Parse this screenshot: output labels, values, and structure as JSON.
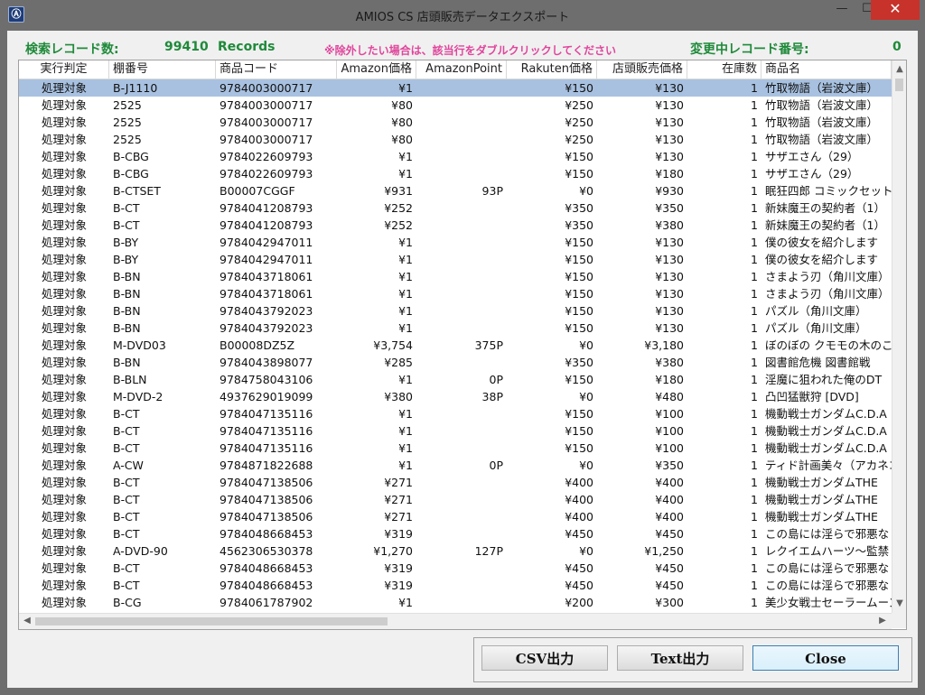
{
  "window": {
    "title": "AMIOS CS 店頭販売データエクスポート",
    "minimize_glyph": "—",
    "maximize_glyph": "☐",
    "close_glyph": "✕"
  },
  "info": {
    "search_count_label": "検索レコード数:",
    "search_count_value": "99410",
    "records_label": "Records",
    "notice": "※除外したい場合は、該当行をダブルクリックしてください",
    "changing_label": "変更中レコード番号:",
    "changing_value": "0"
  },
  "columns": [
    "実行判定",
    "棚番号",
    "商品コード",
    "Amazon価格",
    "AmazonPoint",
    "Rakuten価格",
    "店頭販売価格",
    "在庫数",
    "商品名"
  ],
  "rows": [
    [
      "処理対象",
      "B-J1110",
      "9784003000717",
      "¥1",
      "",
      "¥150",
      "¥130",
      "1",
      "竹取物語（岩波文庫）"
    ],
    [
      "処理対象",
      "2525",
      "9784003000717",
      "¥80",
      "",
      "¥250",
      "¥130",
      "1",
      "竹取物語（岩波文庫）"
    ],
    [
      "処理対象",
      "2525",
      "9784003000717",
      "¥80",
      "",
      "¥250",
      "¥130",
      "1",
      "竹取物語（岩波文庫）"
    ],
    [
      "処理対象",
      "2525",
      "9784003000717",
      "¥80",
      "",
      "¥250",
      "¥130",
      "1",
      "竹取物語（岩波文庫）"
    ],
    [
      "処理対象",
      "B-CBG",
      "9784022609793",
      "¥1",
      "",
      "¥150",
      "¥130",
      "1",
      "サザエさん（29）"
    ],
    [
      "処理対象",
      "B-CBG",
      "9784022609793",
      "¥1",
      "",
      "¥150",
      "¥180",
      "1",
      "サザエさん（29）"
    ],
    [
      "処理対象",
      "B-CTSET",
      "B00007CGGF",
      "¥931",
      "93P",
      "¥0",
      "¥930",
      "1",
      "眠狂四郎 コミックセット"
    ],
    [
      "処理対象",
      "B-CT",
      "9784041208793",
      "¥252",
      "",
      "¥350",
      "¥350",
      "1",
      "新妹魔王の契約者（1）"
    ],
    [
      "処理対象",
      "B-CT",
      "9784041208793",
      "¥252",
      "",
      "¥350",
      "¥380",
      "1",
      "新妹魔王の契約者（1）"
    ],
    [
      "処理対象",
      "B-BY",
      "9784042947011",
      "¥1",
      "",
      "¥150",
      "¥130",
      "1",
      "僕の彼女を紹介します"
    ],
    [
      "処理対象",
      "B-BY",
      "9784042947011",
      "¥1",
      "",
      "¥150",
      "¥130",
      "1",
      "僕の彼女を紹介します"
    ],
    [
      "処理対象",
      "B-BN",
      "9784043718061",
      "¥1",
      "",
      "¥150",
      "¥130",
      "1",
      "さまよう刃（角川文庫）"
    ],
    [
      "処理対象",
      "B-BN",
      "9784043718061",
      "¥1",
      "",
      "¥150",
      "¥130",
      "1",
      "さまよう刃（角川文庫）"
    ],
    [
      "処理対象",
      "B-BN",
      "9784043792023",
      "¥1",
      "",
      "¥150",
      "¥130",
      "1",
      "パズル（角川文庫）"
    ],
    [
      "処理対象",
      "B-BN",
      "9784043792023",
      "¥1",
      "",
      "¥150",
      "¥130",
      "1",
      "パズル（角川文庫）"
    ],
    [
      "処理対象",
      "M-DVD03",
      "B00008DZ5Z",
      "¥3,754",
      "375P",
      "¥0",
      "¥3,180",
      "1",
      "ぼのぼの クモモの木のこ"
    ],
    [
      "処理対象",
      "B-BN",
      "9784043898077",
      "¥285",
      "",
      "¥350",
      "¥380",
      "1",
      "図書館危機 図書館戦"
    ],
    [
      "処理対象",
      "B-BLN",
      "9784758043106",
      "¥1",
      "0P",
      "¥150",
      "¥180",
      "1",
      "淫魔に狙われた俺のDT"
    ],
    [
      "処理対象",
      "M-DVD-2",
      "4937629019099",
      "¥380",
      "38P",
      "¥0",
      "¥480",
      "1",
      "凸凹猛獣狩 [DVD]"
    ],
    [
      "処理対象",
      "B-CT",
      "9784047135116",
      "¥1",
      "",
      "¥150",
      "¥100",
      "1",
      "機動戦士ガンダムC.D.A"
    ],
    [
      "処理対象",
      "B-CT",
      "9784047135116",
      "¥1",
      "",
      "¥150",
      "¥100",
      "1",
      "機動戦士ガンダムC.D.A"
    ],
    [
      "処理対象",
      "B-CT",
      "9784047135116",
      "¥1",
      "",
      "¥150",
      "¥100",
      "1",
      "機動戦士ガンダムC.D.A"
    ],
    [
      "処理対象",
      "A-CW",
      "9784871822688",
      "¥1",
      "0P",
      "¥0",
      "¥350",
      "1",
      "ティド計画美々（アカネコ"
    ],
    [
      "処理対象",
      "B-CT",
      "9784047138506",
      "¥271",
      "",
      "¥400",
      "¥400",
      "1",
      "機動戦士ガンダムTHE"
    ],
    [
      "処理対象",
      "B-CT",
      "9784047138506",
      "¥271",
      "",
      "¥400",
      "¥400",
      "1",
      "機動戦士ガンダムTHE"
    ],
    [
      "処理対象",
      "B-CT",
      "9784047138506",
      "¥271",
      "",
      "¥400",
      "¥400",
      "1",
      "機動戦士ガンダムTHE"
    ],
    [
      "処理対象",
      "B-CT",
      "9784048668453",
      "¥319",
      "",
      "¥450",
      "¥450",
      "1",
      "この島には淫らで邪悪な"
    ],
    [
      "処理対象",
      "A-DVD-90",
      "4562306530378",
      "¥1,270",
      "127P",
      "¥0",
      "¥1,250",
      "1",
      "レクイエムハーツ〜監禁"
    ],
    [
      "処理対象",
      "B-CT",
      "9784048668453",
      "¥319",
      "",
      "¥450",
      "¥450",
      "1",
      "この島には淫らで邪悪な"
    ],
    [
      "処理対象",
      "B-CT",
      "9784048668453",
      "¥319",
      "",
      "¥450",
      "¥450",
      "1",
      "この島には淫らで邪悪な"
    ],
    [
      "処理対象",
      "B-CG",
      "9784061787902",
      "¥1",
      "",
      "¥200",
      "¥300",
      "1",
      "美少女戦士セーラームーン"
    ]
  ],
  "selected_row": 0,
  "buttons": {
    "csv": "CSV出力",
    "text": "Text出力",
    "close": "Close"
  },
  "scroll": {
    "up": "▲",
    "down": "▼",
    "left": "◀",
    "right": "▶"
  }
}
